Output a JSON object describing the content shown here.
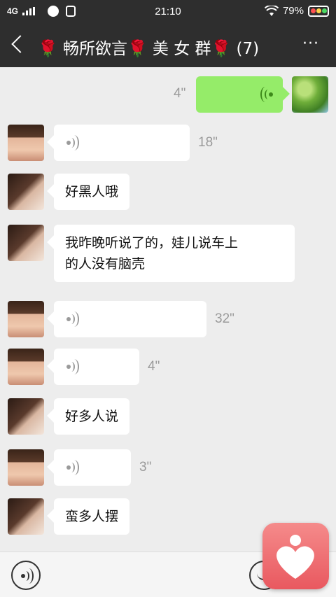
{
  "status_bar": {
    "network": "4G",
    "time": "21:10",
    "battery": "79%",
    "battery_dot_colors": [
      "#ff5252",
      "#ffd24a",
      "#4cd964"
    ]
  },
  "header": {
    "title": "🌹 畅所欲言🌹 美 女 群🌹 (7)",
    "back_icon": "chevron-left-icon",
    "more_icon": "more-dots-icon",
    "more_label": "···"
  },
  "messages": [
    {
      "type": "voice",
      "from": "me",
      "duration": "4\"",
      "avatar": "tree-avatar"
    },
    {
      "type": "voice",
      "from": "girl",
      "duration": "18\""
    },
    {
      "type": "text",
      "from": "lady",
      "text": "好黑人哦"
    },
    {
      "type": "text",
      "from": "lady",
      "text_lines": [
        "我昨晚听说了的，娃儿说车上",
        "的人没有脑壳"
      ]
    },
    {
      "type": "voice",
      "from": "girl",
      "duration": "32\""
    },
    {
      "type": "voice",
      "from": "girl",
      "duration": "4\""
    },
    {
      "type": "text",
      "from": "lady",
      "text": "好多人说"
    },
    {
      "type": "voice",
      "from": "girl",
      "duration": "3\""
    },
    {
      "type": "text",
      "from": "lady",
      "text": "蛮多人摆"
    }
  ],
  "colors": {
    "header_bg": "#2e2e2e",
    "chat_bg": "#ededed",
    "my_bubble": "#95ec69",
    "other_bubble": "#ffffff",
    "widget": "#ef6f72"
  },
  "input_bar": {
    "voice_toggle_icon": "voice-icon",
    "emoji_icon": "emoji-icon"
  },
  "floating_widget": {
    "icon": "heart-person-icon"
  }
}
